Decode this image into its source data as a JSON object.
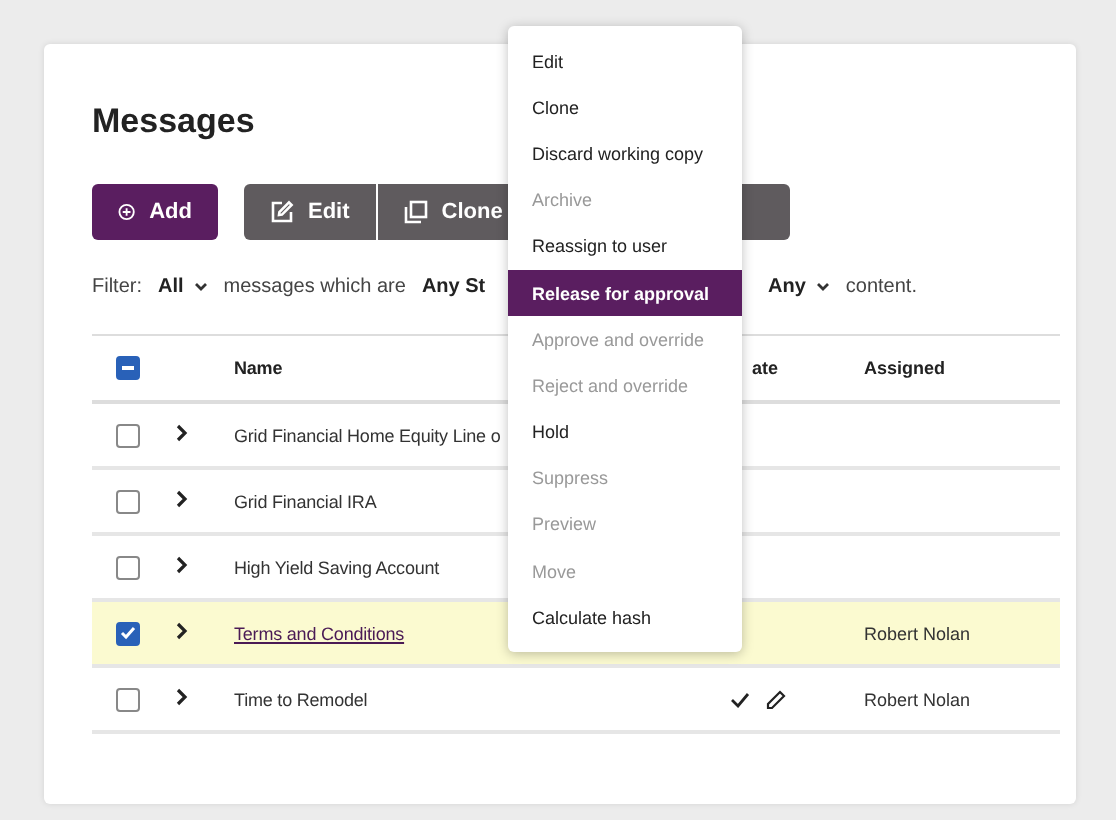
{
  "title": "Messages",
  "toolbar": {
    "add": "Add",
    "buttons": [
      {
        "kind": "edit",
        "label": "Edit"
      },
      {
        "kind": "clone",
        "label": "Clone"
      },
      {
        "kind": "blank"
      }
    ]
  },
  "filter": {
    "label": "Filter:",
    "scope": "All",
    "middle": "messages which are",
    "state": "Any St",
    "content_scope": "Any",
    "end": "content."
  },
  "table": {
    "header_checkbox": {
      "indeterminate": true
    },
    "columns": [
      "Name",
      "ate",
      "Assigned"
    ],
    "rows": [
      {
        "name": "Grid Financial Home Equity Line o",
        "checked": false,
        "selected": false,
        "approved": false,
        "editable": false,
        "assigned": ""
      },
      {
        "name": "Grid Financial IRA",
        "checked": false,
        "selected": false,
        "approved": false,
        "editable": false,
        "assigned": ""
      },
      {
        "name": "High Yield Saving Account",
        "checked": false,
        "selected": false,
        "approved": false,
        "editable": false,
        "assigned": ""
      },
      {
        "name": "Terms and Conditions",
        "checked": true,
        "selected": true,
        "approved": false,
        "editable": false,
        "assigned": "Robert Nolan"
      },
      {
        "name": "Time to Remodel",
        "checked": false,
        "selected": false,
        "approved": true,
        "editable": true,
        "assigned": "Robert Nolan"
      }
    ]
  },
  "menu": [
    {
      "label": "Edit",
      "disabled": false,
      "selected": false
    },
    {
      "label": "Clone",
      "disabled": false,
      "selected": false
    },
    {
      "label": "Discard working copy",
      "disabled": false,
      "selected": false
    },
    {
      "label": "Archive",
      "disabled": true,
      "selected": false
    },
    {
      "label": "Reassign to user",
      "disabled": false,
      "selected": false
    },
    {
      "label": "Release for approval",
      "disabled": false,
      "selected": true
    },
    {
      "label": "Approve and override",
      "disabled": true,
      "selected": false
    },
    {
      "label": "Reject and override",
      "disabled": true,
      "selected": false
    },
    {
      "label": "Hold",
      "disabled": false,
      "selected": false
    },
    {
      "label": "Suppress",
      "disabled": true,
      "selected": false
    },
    {
      "label": "Preview",
      "disabled": true,
      "selected": false
    },
    {
      "label": "Move",
      "disabled": true,
      "selected": false
    },
    {
      "label": "Calculate hash",
      "disabled": false,
      "selected": false
    }
  ]
}
